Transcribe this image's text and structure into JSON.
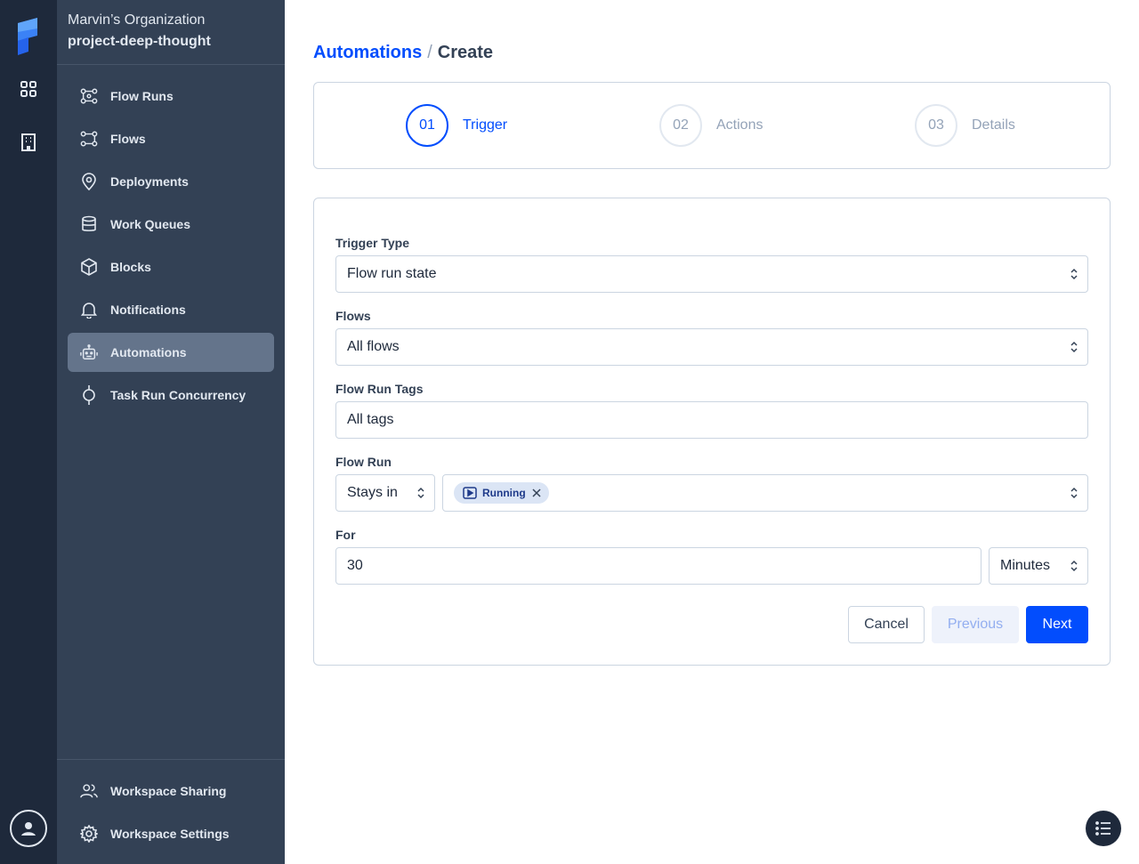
{
  "rail": {
    "items": [
      {
        "icon": "grid-icon"
      },
      {
        "icon": "building-icon"
      }
    ],
    "account_icon": "user-circle-icon"
  },
  "sidebar": {
    "organization": "Marvin’s Organization",
    "workspace": "project-deep-thought",
    "items": [
      {
        "label": "Flow Runs",
        "icon": "flow-runs-icon"
      },
      {
        "label": "Flows",
        "icon": "flows-icon"
      },
      {
        "label": "Deployments",
        "icon": "map-pin-icon"
      },
      {
        "label": "Work Queues",
        "icon": "database-icon"
      },
      {
        "label": "Blocks",
        "icon": "cube-icon"
      },
      {
        "label": "Notifications",
        "icon": "bell-icon"
      },
      {
        "label": "Automations",
        "icon": "robot-icon",
        "active": true
      },
      {
        "label": "Task Run Concurrency",
        "icon": "concurrency-icon"
      }
    ],
    "footer": [
      {
        "label": "Workspace Sharing",
        "icon": "users-icon"
      },
      {
        "label": "Workspace Settings",
        "icon": "gear-icon"
      }
    ]
  },
  "breadcrumb": {
    "parent": "Automations",
    "separator": "/",
    "current": "Create"
  },
  "stepper": {
    "steps": [
      {
        "number": "01",
        "label": "Trigger",
        "active": true
      },
      {
        "number": "02",
        "label": "Actions",
        "active": false
      },
      {
        "number": "03",
        "label": "Details",
        "active": false
      }
    ]
  },
  "form": {
    "trigger_type": {
      "label": "Trigger Type",
      "value": "Flow run state"
    },
    "flows": {
      "label": "Flows",
      "value": "All flows"
    },
    "flow_run_tags": {
      "label": "Flow Run Tags",
      "value": "All tags"
    },
    "flow_run": {
      "label": "Flow Run",
      "condition": "Stays in",
      "states": [
        {
          "label": "Running",
          "icon": "play-square-icon"
        }
      ]
    },
    "for": {
      "label": "For",
      "value": "30",
      "unit": "Minutes"
    }
  },
  "buttons": {
    "cancel": "Cancel",
    "previous": "Previous",
    "next": "Next"
  },
  "colors": {
    "accent": "#024dfd",
    "rail_bg": "#1e293b",
    "sidebar_bg": "#334155",
    "sidebar_active_bg": "#64748b",
    "tag_bg": "#dbe5f5"
  },
  "fab_icon": "list-icon"
}
